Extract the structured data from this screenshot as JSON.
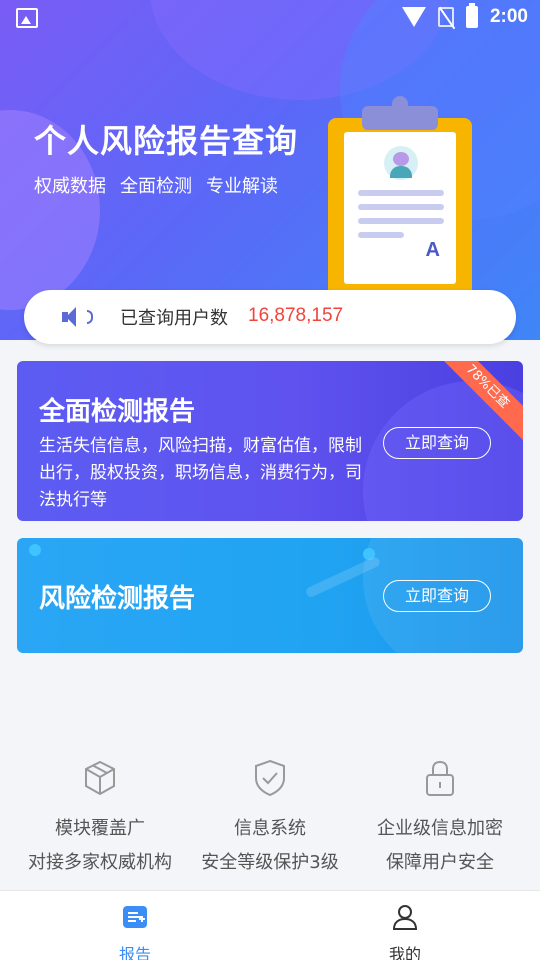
{
  "status_bar": {
    "time": "2:00"
  },
  "hero": {
    "title": "个人风险报告查询",
    "subtitles": [
      "权威数据",
      "全面检测",
      "专业解读"
    ],
    "clipboard_grade": "A"
  },
  "counter": {
    "label": "已查询用户数",
    "value": "16,878,157"
  },
  "cards": [
    {
      "title": "全面检测报告",
      "desc": "生活失信信息，风险扫描，财富估值，限制出行，股权投资，职场信息，消费行为，司法执行等",
      "button": "立即查询",
      "ribbon": "78%已查"
    },
    {
      "title": "风险检测报告",
      "button": "立即查询"
    }
  ],
  "features": [
    {
      "icon": "cube-icon",
      "line1": "模块覆盖广",
      "line2": "对接多家权威机构"
    },
    {
      "icon": "shield-check-icon",
      "line1": "信息系统",
      "line2": "安全等级保护3级"
    },
    {
      "icon": "lock-icon",
      "line1": "企业级信息加密",
      "line2": "保障用户安全"
    }
  ],
  "tabs": [
    {
      "label": "报告",
      "icon": "report-icon",
      "active": true
    },
    {
      "label": "我的",
      "icon": "user-icon",
      "active": false
    }
  ],
  "colors": {
    "accent": "#3f86f8",
    "active_tab": "#3a8ef6",
    "counter_value": "#f0443d",
    "ribbon": "#ff6a4e"
  }
}
